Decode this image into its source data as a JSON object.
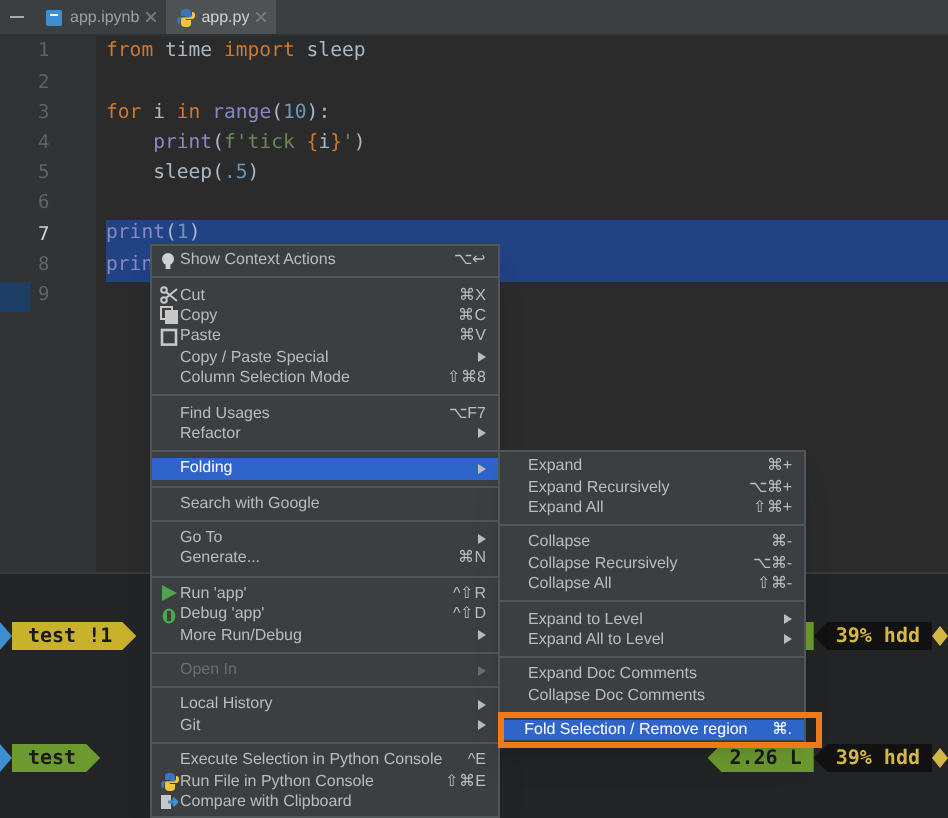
{
  "tabs": [
    {
      "label": "app.ipynb",
      "kind": "notebook",
      "selected": false
    },
    {
      "label": "app.py",
      "kind": "python",
      "selected": true
    }
  ],
  "editor": {
    "lines": [
      {
        "number": "1",
        "selected": false,
        "current": false,
        "tokens": [
          {
            "text": "from",
            "kind": "keyword"
          },
          {
            "text": " time ",
            "kind": "plain"
          },
          {
            "text": "import",
            "kind": "keyword"
          },
          {
            "text": " sleep",
            "kind": "plain"
          }
        ]
      },
      {
        "number": "2",
        "selected": false,
        "current": false
      },
      {
        "number": "3",
        "selected": false,
        "current": false,
        "tokens": [
          {
            "text": "for",
            "kind": "keyword"
          },
          {
            "text": " i ",
            "kind": "plain"
          },
          {
            "text": "in",
            "kind": "keyword"
          },
          {
            "text": " range",
            "kind": "builtin"
          },
          {
            "text": "(",
            "kind": "plain"
          },
          {
            "text": "10",
            "kind": "number"
          },
          {
            "text": "):",
            "kind": "plain"
          }
        ]
      },
      {
        "number": "4",
        "selected": false,
        "current": false,
        "tokens": [
          {
            "text": "    print",
            "kind": "builtin"
          },
          {
            "text": "(",
            "kind": "plain"
          },
          {
            "text": "f'tick ",
            "kind": "string"
          },
          {
            "text": "{",
            "kind": "keyword"
          },
          {
            "text": "i",
            "kind": "plain"
          },
          {
            "text": "}",
            "kind": "keyword"
          },
          {
            "text": "'",
            "kind": "string"
          },
          {
            "text": ")",
            "kind": "plain"
          }
        ]
      },
      {
        "number": "5",
        "selected": false,
        "current": false,
        "tokens": [
          {
            "text": "    sleep(",
            "kind": "plain"
          },
          {
            "text": ".5",
            "kind": "number"
          },
          {
            "text": ")",
            "kind": "plain"
          }
        ]
      },
      {
        "number": "6",
        "selected": false,
        "current": false
      },
      {
        "number": "7",
        "selected": true,
        "current": true,
        "tokens": [
          {
            "text": "print",
            "kind": "builtin"
          },
          {
            "text": "(",
            "kind": "plain"
          },
          {
            "text": "1",
            "kind": "number"
          },
          {
            "text": ")",
            "kind": "plain"
          }
        ]
      },
      {
        "number": "8",
        "selected": true,
        "current": false,
        "tokens": [
          {
            "text": "prin",
            "kind": "builtin"
          }
        ]
      },
      {
        "number": "9",
        "selected": false,
        "current": false
      }
    ]
  },
  "terminal": {
    "prompts": [
      {
        "left": [
          {
            "text": "test !1",
            "color": "#c9b22b"
          }
        ],
        "right": [
          {
            "color": "#6c9a2e"
          },
          {
            "text": "39% hdd",
            "color": "#121212"
          }
        ]
      },
      {
        "left": [
          {
            "text": "test",
            "color": "#6c9a2e"
          }
        ],
        "right": [
          {
            "text": "2.26 L",
            "color": "#6c9a2e"
          },
          {
            "text": "39% hdd",
            "color": "#121212"
          }
        ]
      }
    ]
  },
  "context_menu": {
    "groups": [
      [
        {
          "label": "Show Context Actions",
          "kind": "bulb",
          "shortcut": "⌥↩",
          "submenu": false,
          "selected": false,
          "disabled": false
        }
      ],
      [
        {
          "label": "Cut",
          "kind": "scissors",
          "shortcut": "⌘X",
          "submenu": false,
          "selected": false,
          "disabled": false
        },
        {
          "label": "Copy",
          "kind": "copy",
          "shortcut": "⌘C",
          "submenu": false,
          "selected": false,
          "disabled": false
        },
        {
          "label": "Paste",
          "kind": "paste",
          "shortcut": "⌘V",
          "submenu": false,
          "selected": false,
          "disabled": false
        },
        {
          "label": "Copy / Paste Special",
          "submenu": true,
          "selected": false,
          "disabled": false
        },
        {
          "label": "Column Selection Mode",
          "shortcut": "⇧⌘8",
          "submenu": false,
          "selected": false,
          "disabled": false
        }
      ],
      [
        {
          "label": "Find Usages",
          "shortcut": "⌥F7",
          "submenu": false,
          "selected": false,
          "disabled": false
        },
        {
          "label": "Refactor",
          "submenu": true,
          "selected": false,
          "disabled": false
        }
      ],
      [
        {
          "label": "Folding",
          "submenu": true,
          "selected": true,
          "disabled": false
        }
      ],
      [
        {
          "label": "Search with Google",
          "submenu": false,
          "selected": false,
          "disabled": false
        }
      ],
      [
        {
          "label": "Go To",
          "submenu": true,
          "selected": false,
          "disabled": false
        },
        {
          "label": "Generate...",
          "shortcut": "⌘N",
          "submenu": false,
          "selected": false,
          "disabled": false
        }
      ],
      [
        {
          "label": "Run 'app'",
          "kind": "run",
          "shortcut": "^⇧R",
          "submenu": false,
          "selected": false,
          "disabled": false
        },
        {
          "label": "Debug 'app'",
          "kind": "debug",
          "shortcut": "^⇧D",
          "submenu": false,
          "selected": false,
          "disabled": false
        },
        {
          "label": "More Run/Debug",
          "submenu": true,
          "selected": false,
          "disabled": false
        }
      ],
      [
        {
          "label": "Open In",
          "submenu": true,
          "selected": false,
          "disabled": true
        }
      ],
      [
        {
          "label": "Local History",
          "submenu": true,
          "selected": false,
          "disabled": false
        },
        {
          "label": "Git",
          "submenu": true,
          "selected": false,
          "disabled": false
        }
      ],
      [
        {
          "label": "Execute Selection in Python Console",
          "shortcut": "^E",
          "submenu": false,
          "selected": false,
          "disabled": false
        },
        {
          "label": "Run File in Python Console",
          "kind": "python",
          "shortcut": "⇧⌘E",
          "submenu": false,
          "selected": false,
          "disabled": false
        },
        {
          "label": "Compare with Clipboard",
          "kind": "compare",
          "submenu": false,
          "selected": false,
          "disabled": false
        }
      ]
    ]
  },
  "submenu": {
    "groups": [
      [
        {
          "label": "Expand",
          "shortcut": "⌘+",
          "submenu": false,
          "selected": false,
          "outlined": false
        },
        {
          "label": "Expand Recursively",
          "shortcut": "⌥⌘+",
          "submenu": false,
          "selected": false,
          "outlined": false
        },
        {
          "label": "Expand All",
          "shortcut": "⇧⌘+",
          "submenu": false,
          "selected": false,
          "outlined": false
        }
      ],
      [
        {
          "label": "Collapse",
          "shortcut": "⌘-",
          "submenu": false,
          "selected": false,
          "outlined": false
        },
        {
          "label": "Collapse Recursively",
          "shortcut": "⌥⌘-",
          "submenu": false,
          "selected": false,
          "outlined": false
        },
        {
          "label": "Collapse All",
          "shortcut": "⇧⌘-",
          "submenu": false,
          "selected": false,
          "outlined": false
        }
      ],
      [
        {
          "label": "Expand to Level",
          "submenu": true,
          "selected": false,
          "outlined": false
        },
        {
          "label": "Expand All to Level",
          "submenu": true,
          "selected": false,
          "outlined": false
        }
      ],
      [
        {
          "label": "Expand Doc Comments",
          "submenu": false,
          "selected": false,
          "outlined": false
        },
        {
          "label": "Collapse Doc Comments",
          "submenu": false,
          "selected": false,
          "outlined": false
        }
      ],
      [
        {
          "label": "Fold Selection / Remove region",
          "shortcut": "⌘.",
          "submenu": false,
          "selected": true,
          "outlined": true
        }
      ]
    ]
  }
}
